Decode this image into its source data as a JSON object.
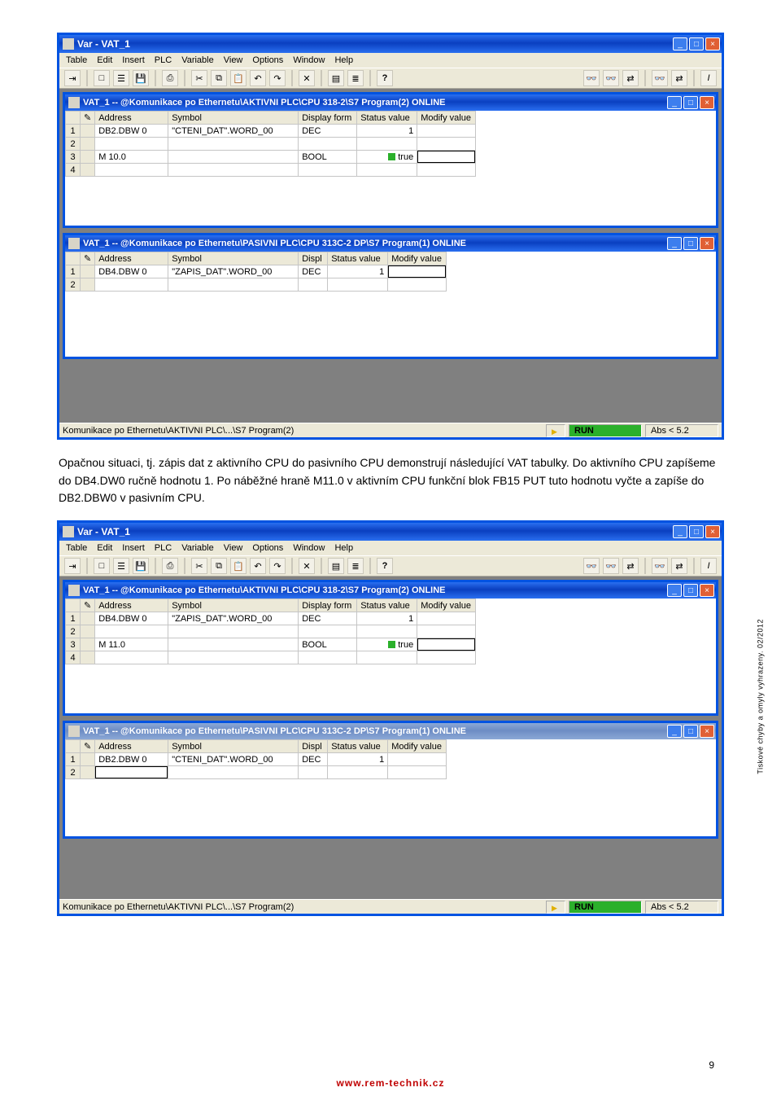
{
  "outer_window_title": "Var - VAT_1",
  "menu": [
    "Table",
    "Edit",
    "Insert",
    "PLC",
    "Variable",
    "View",
    "Options",
    "Window",
    "Help"
  ],
  "toolbar_icons": [
    "pin",
    "new",
    "open",
    "save",
    "print",
    "cut",
    "copy",
    "paste",
    "undo",
    "redo",
    "delete",
    "toprow",
    "insrow",
    "help",
    "glasses1",
    "glasses2",
    "arrow1",
    "glasses3",
    "arrow2",
    "italic"
  ],
  "screenshot1": {
    "child1": {
      "title": "VAT_1 -- @Komunikace po Ethernetu\\AKTIVNI PLC\\CPU 318-2\\S7 Program(2)  ONLINE",
      "active": true,
      "headers": [
        "",
        "",
        "Address",
        "Symbol",
        "Display form",
        "Status value",
        "Modify value"
      ],
      "rows": [
        {
          "n": "1",
          "addr": "DB2.DBW   0",
          "sym": "\"CTENI_DAT\".WORD_00",
          "disp": "DEC",
          "stat": "1",
          "mod": ""
        },
        {
          "n": "2",
          "addr": "",
          "sym": "",
          "disp": "",
          "stat": "",
          "mod": ""
        },
        {
          "n": "3",
          "addr": "M    10.0",
          "sym": "",
          "disp": "BOOL",
          "stat": "true",
          "mod": "",
          "bool": true,
          "cur": true
        },
        {
          "n": "4",
          "addr": "",
          "sym": "",
          "disp": "",
          "stat": "",
          "mod": ""
        }
      ]
    },
    "child2": {
      "title": "VAT_1 -- @Komunikace po Ethernetu\\PASIVNI PLC\\CPU 313C-2 DP\\S7 Program(1)  ONLINE",
      "active": true,
      "headers": [
        "",
        "",
        "Address",
        "Symbol",
        "Displ",
        "Status value",
        "Modify value"
      ],
      "rows": [
        {
          "n": "1",
          "addr": "DB4.DBW   0",
          "sym": "\"ZAPIS_DAT\".WORD_00",
          "disp": "DEC",
          "stat": "1",
          "mod": "",
          "cur": true
        },
        {
          "n": "2",
          "addr": "",
          "sym": "",
          "disp": "",
          "stat": "",
          "mod": ""
        }
      ]
    },
    "status_path": "Komunikace po Ethernetu\\AKTIVNI PLC\\...\\S7 Program(2)",
    "status_run": "RUN",
    "status_abs": "Abs < 5.2"
  },
  "paragraph": "Opačnou situaci, tj. zápis dat z aktivního CPU do pasivního CPU demonstrují následující VAT tabulky. Do aktivního CPU zapíšeme do DB4.DW0 ručně hodnotu 1. Po náběžné hraně M11.0 v aktivním CPU funkční blok FB15 PUT tuto hodnotu vyčte a zapíše do DB2.DBW0 v pasivním CPU.",
  "screenshot2": {
    "child1": {
      "title": "VAT_1 -- @Komunikace po Ethernetu\\AKTIVNI PLC\\CPU 318-2\\S7 Program(2)  ONLINE",
      "active": true,
      "headers": [
        "",
        "",
        "Address",
        "Symbol",
        "Display form",
        "Status value",
        "Modify value"
      ],
      "rows": [
        {
          "n": "1",
          "addr": "DB4.DBW   0",
          "sym": "\"ZAPIS_DAT\".WORD_00",
          "disp": "DEC",
          "stat": "1",
          "mod": ""
        },
        {
          "n": "2",
          "addr": "",
          "sym": "",
          "disp": "",
          "stat": "",
          "mod": ""
        },
        {
          "n": "3",
          "addr": "M    11.0",
          "sym": "",
          "disp": "BOOL",
          "stat": "true",
          "mod": "",
          "bool": true,
          "cur": true
        },
        {
          "n": "4",
          "addr": "",
          "sym": "",
          "disp": "",
          "stat": "",
          "mod": ""
        }
      ]
    },
    "child2": {
      "title": "VAT_1 -- @Komunikace po Ethernetu\\PASIVNI PLC\\CPU 313C-2 DP\\S7 Program(1)  ONLINE",
      "active": false,
      "headers": [
        "",
        "",
        "Address",
        "Symbol",
        "Displ",
        "Status value",
        "Modify value"
      ],
      "rows": [
        {
          "n": "1",
          "addr": "DB2.DBW   0",
          "sym": "\"CTENI_DAT\".WORD_00",
          "disp": "DEC",
          "stat": "1",
          "mod": ""
        },
        {
          "n": "2",
          "addr": "",
          "sym": "",
          "disp": "",
          "stat": "",
          "mod": "",
          "cur": true,
          "curaddr": true
        }
      ]
    },
    "status_path": "Komunikace po Ethernetu\\AKTIVNI PLC\\...\\S7 Program(2)",
    "status_run": "RUN",
    "status_abs": "Abs < 5.2"
  },
  "page_number": "9",
  "footer_url": "www.rem-technik.cz",
  "side_note": "Tiskové chyby a omyly vyhrazeny. 02/2012"
}
